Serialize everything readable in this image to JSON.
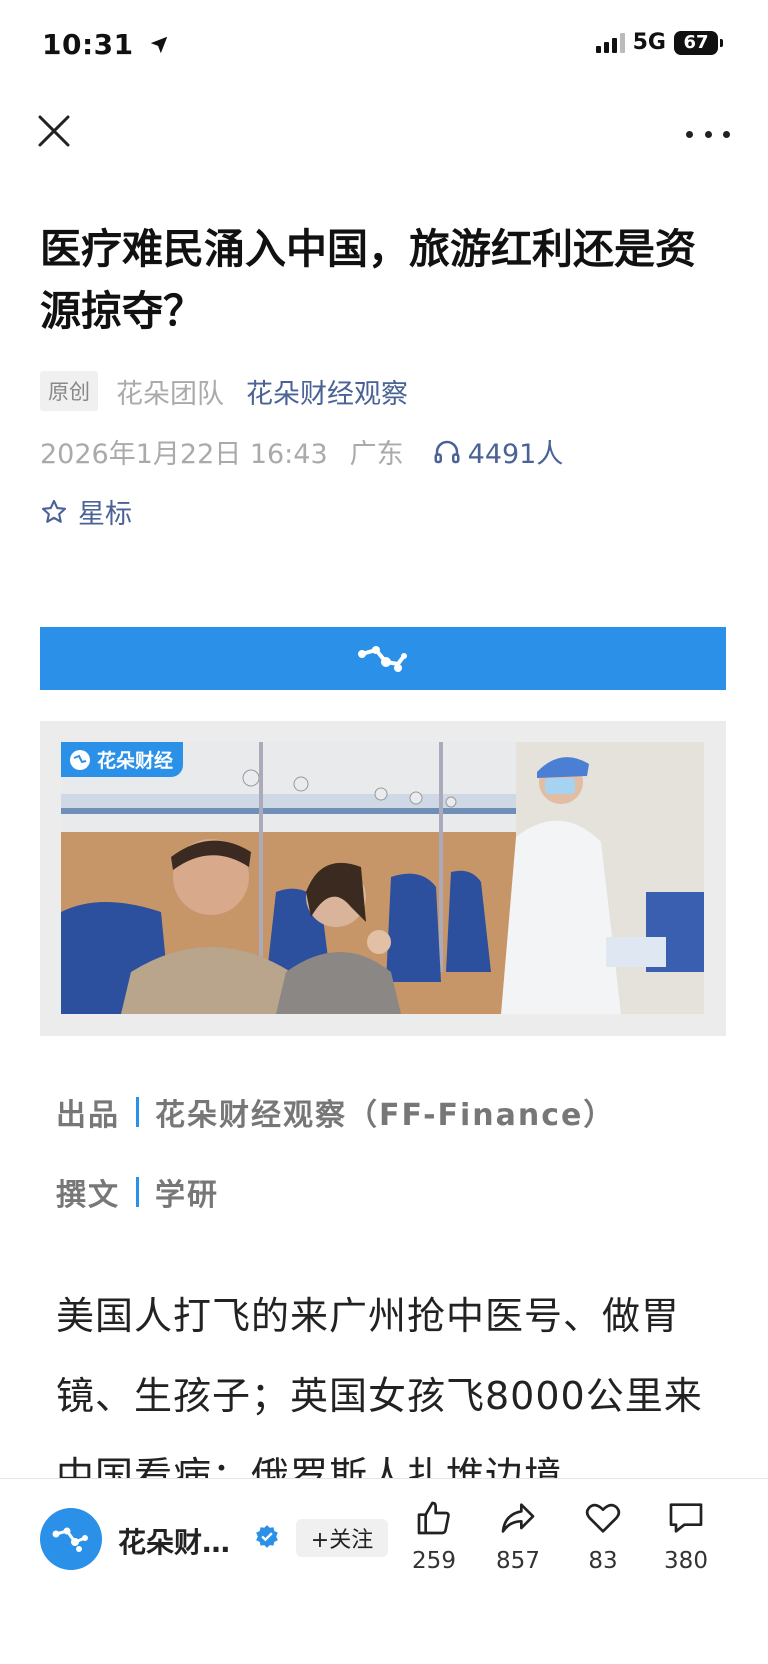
{
  "status_bar": {
    "time": "10:31",
    "network": "5G",
    "battery": "67"
  },
  "article": {
    "title": "医疗难民涌入中国，旅游红利还是资源掠夺？",
    "original_tag": "原创",
    "author": "花朵团队",
    "account": "花朵财经观察",
    "date": "2026年1月22日 16:43",
    "location": "广东",
    "listeners": "4491人",
    "star_label": "星标"
  },
  "image": {
    "watermark": "花朵财经"
  },
  "credits": [
    {
      "label": "出品",
      "value": "花朵财经观察（FF-Finance）"
    },
    {
      "label": "撰文",
      "value": "学研"
    }
  ],
  "body": {
    "paragraph": "美国人打飞的来广州抢中医号、做胃镜、生孩子；英国女孩飞8000公里来中国看病；俄罗斯人扎堆边境"
  },
  "bottom_bar": {
    "account_name": "花朵财…",
    "follow_label": "+关注",
    "actions": [
      {
        "icon": "thumbs-up-icon",
        "count": "259"
      },
      {
        "icon": "share-icon",
        "count": "857"
      },
      {
        "icon": "heart-icon",
        "count": "83"
      },
      {
        "icon": "comment-icon",
        "count": "380"
      }
    ]
  },
  "colors": {
    "accent": "#2a90e8",
    "link": "#4a6296",
    "muted": "#aaaaaa"
  }
}
